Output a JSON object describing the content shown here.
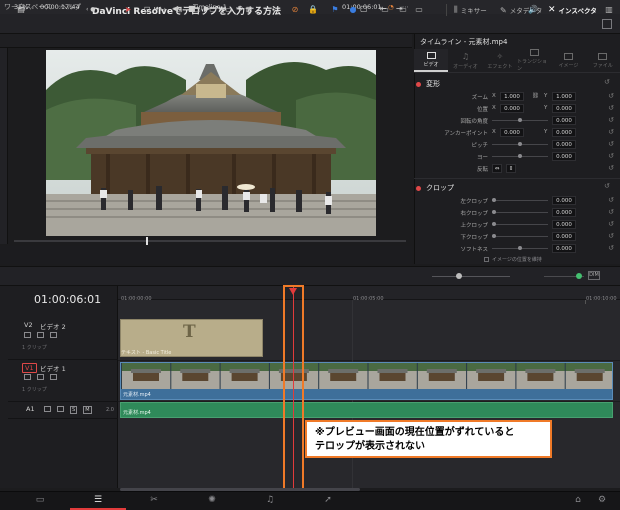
{
  "menu": {
    "items": [
      "ワークスペース",
      "ヘルプ"
    ]
  },
  "header": {
    "title": "DaVinci Resolveでテロップを入力する方法",
    "buttons": [
      "ミキサー",
      "メタデータ",
      "インスペクタ"
    ]
  },
  "viewer": {
    "zoom": "35%",
    "timecode_left": "00:00:17:44",
    "timeline_name": "Timeline 1",
    "timecode_right": "01:00:06:01",
    "transport_icons": [
      "skip-start-icon",
      "step-back-icon",
      "stop-icon",
      "play-icon",
      "step-forward-icon",
      "loop-icon"
    ]
  },
  "inspector": {
    "title": "タイムライン - 元素材.mp4",
    "tabs": [
      "ビデオ",
      "オーディオ",
      "エフェクト",
      "トランジション",
      "イメージ",
      "ファイル"
    ],
    "transform": {
      "header": "変形",
      "zoom_label": "ズーム",
      "zoom_x_label": "X",
      "zoom_x": "1.000",
      "zoom_y_label": "Y",
      "zoom_y": "1.000",
      "position_label": "位置",
      "pos_x_label": "X",
      "pos_x": "0.000",
      "pos_y_label": "Y",
      "pos_y": "0.000",
      "rotation_label": "回転の角度",
      "rotation": "0.000",
      "anchor_label": "アンカーポイント",
      "anchor_x_label": "X",
      "anchor_x": "0.000",
      "anchor_y_label": "Y",
      "anchor_y": "0.000",
      "pitch_label": "ピッチ",
      "pitch": "0.000",
      "yaw_label": "ヨー",
      "yaw": "0.000",
      "flip_label": "反転"
    },
    "crop": {
      "header": "クロップ",
      "left_label": "左クロップ",
      "left": "0.000",
      "right_label": "右クロップ",
      "right": "0.000",
      "top_label": "上クロップ",
      "top": "0.000",
      "bottom_label": "下クロップ",
      "bottom": "0.000",
      "soft_label": "ソフトネス",
      "soft": "0.000",
      "retain_label": "イメージの位置を維持"
    }
  },
  "timeline": {
    "timecode": "01:00:06:01",
    "ruler_labels": [
      "01:00:00:00",
      "01:00:05:00",
      "01:00:10:00"
    ],
    "tracks": [
      {
        "id": "V2",
        "name": "ビデオ 2",
        "clips": "1 クリップ"
      },
      {
        "id": "V1",
        "name": "ビデオ 1",
        "clips": "1 クリップ"
      },
      {
        "id": "A1",
        "name": "",
        "level": "2.0"
      }
    ],
    "clips": {
      "text": {
        "glyph": "T",
        "label": "テキスト - Basic Title"
      },
      "video": {
        "label": "元素材.mp4"
      },
      "audio": {
        "label": "元素材.mp4"
      }
    }
  },
  "annotation": {
    "line1": "※プレビュー画面の現在位置がずれていると",
    "line2": "テロップが表示されない",
    "color": "#f07a28"
  },
  "pages": [
    "media-page-icon",
    "cut-page-icon",
    "edit-page-icon",
    "fusion-page-icon",
    "color-page-icon",
    "fairlight-page-icon",
    "deliver-page-icon"
  ]
}
